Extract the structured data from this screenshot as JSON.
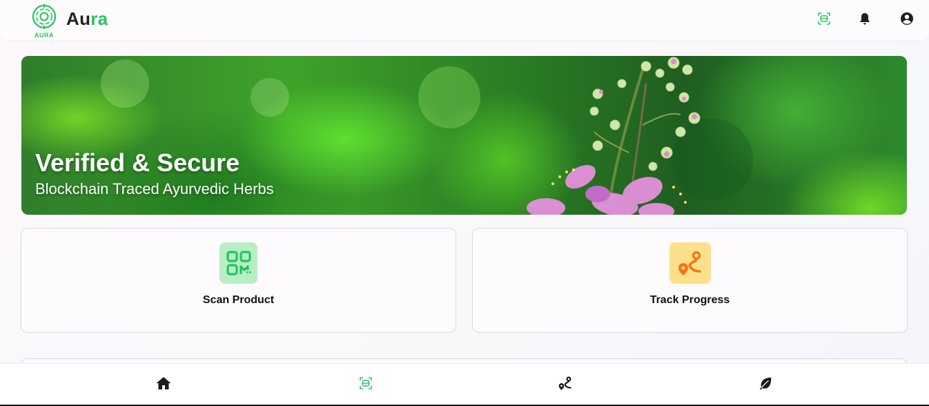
{
  "header": {
    "logo_caption": "AURA",
    "app_name_main": "Au",
    "app_name_accent": "ra",
    "icons": [
      "scan-icon",
      "bell-icon",
      "account-icon"
    ]
  },
  "hero": {
    "title": "Verified & Secure",
    "subtitle": "Blockchain Traced Ayurvedic Herbs"
  },
  "actions": [
    {
      "label": "Scan Product",
      "icon": "qr-code-icon",
      "icon_bg": "#b7eec6",
      "icon_color": "#22c55e"
    },
    {
      "label": "Track Progress",
      "icon": "route-icon",
      "icon_bg": "#fde08a",
      "icon_color": "#f97316"
    }
  ],
  "bottom_nav": [
    "home-icon",
    "scan-icon",
    "route-icon",
    "leaf-icon"
  ],
  "colors": {
    "brand_green": "#22c55e",
    "accent_orange": "#f97316"
  }
}
